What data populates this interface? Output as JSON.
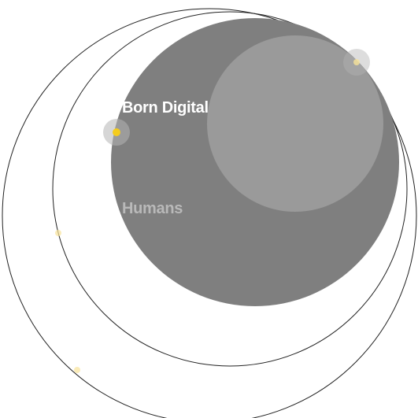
{
  "diagram": {
    "labels": {
      "born_digital": "Born Digital",
      "humans": "Humans"
    },
    "colors": {
      "background": "#ffffff",
      "outline": "#222222",
      "large_circle": "#7f7f7f",
      "inner_circle": "#9a9a9a",
      "halo": "#b4b4b4",
      "marker": "#f5cc1c",
      "marker_faint": "#f8e39a",
      "born_digital_text": "#ffffff",
      "humans_text": "#b9b9b9"
    }
  }
}
